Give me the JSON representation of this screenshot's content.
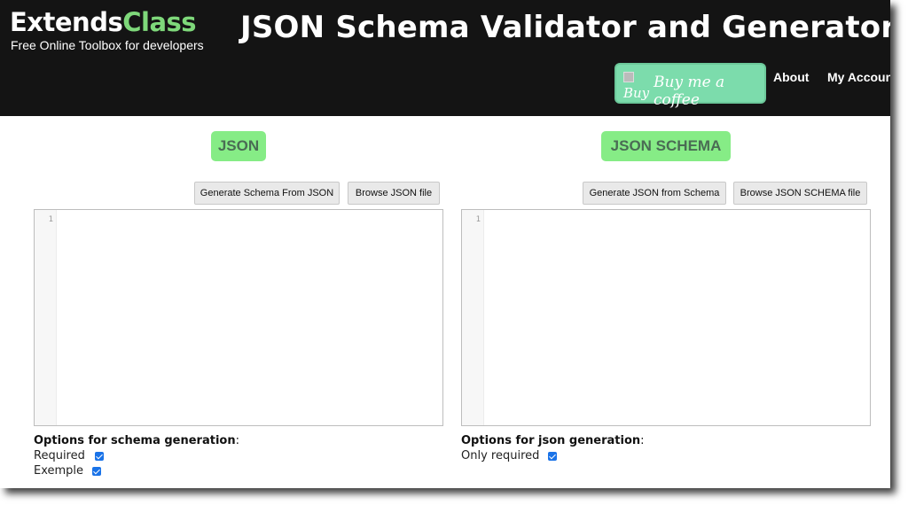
{
  "header": {
    "logo_main": "Extends",
    "logo_accent": "Class",
    "tagline": "Free Online Toolbox for developers",
    "page_title": "JSON Schema Validator and Generator",
    "coffee_alt": "Buy",
    "coffee_label": "Buy me a coffee",
    "nav": {
      "about": "About",
      "account": "My Account"
    }
  },
  "left_panel": {
    "heading": "JSON",
    "buttons": {
      "generate": "Generate Schema From JSON",
      "browse": "Browse JSON file"
    },
    "editor": {
      "line_numbers": [
        "1"
      ]
    },
    "options": {
      "title": "Options for schema generation",
      "items": [
        {
          "label": "Required",
          "checked": true
        },
        {
          "label": "Exemple",
          "checked": true
        }
      ]
    }
  },
  "right_panel": {
    "heading": "JSON SCHEMA",
    "buttons": {
      "generate": "Generate JSON from Schema",
      "browse": "Browse JSON SCHEMA file"
    },
    "editor": {
      "line_numbers": [
        "1"
      ]
    },
    "options": {
      "title": "Options for json generation",
      "items": [
        {
          "label": "Only required",
          "checked": true
        }
      ]
    }
  },
  "colors": {
    "header_bg": "#141414",
    "logo_accent": "#7ed87a",
    "pill_bg": "#86ec86",
    "coffee_bg": "#7cdcac",
    "checkbox": "#1a73e8"
  }
}
